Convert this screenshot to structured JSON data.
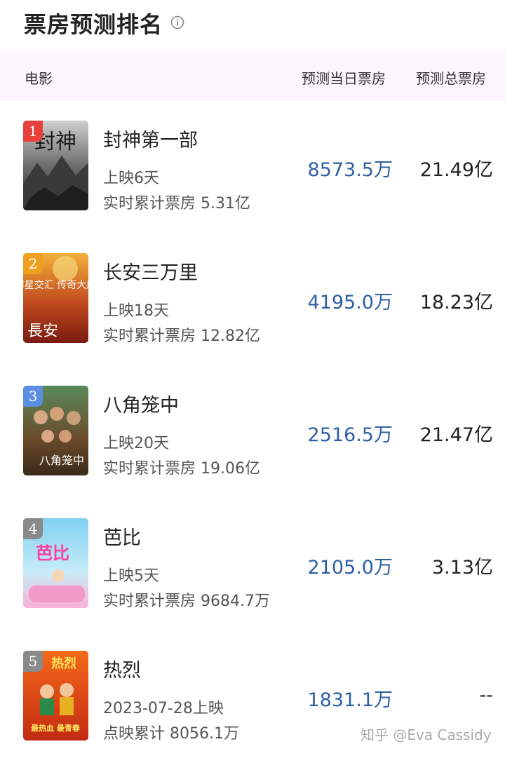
{
  "header": {
    "title": "票房预测排名",
    "info_icon": "info-circle-icon"
  },
  "columns": {
    "movie": "电影",
    "today": "预测当日票房",
    "total": "预测总票房"
  },
  "movies": [
    {
      "rank": "1",
      "title": "封神第一部",
      "meta1": "上映6天",
      "meta2": "实时累计票房 5.31亿",
      "today": "8573.5万",
      "total": "21.49亿",
      "rank_color": "#e8403a"
    },
    {
      "rank": "2",
      "title": "长安三万里",
      "meta1": "上映18天",
      "meta2": "实时累计票房 12.82亿",
      "today": "4195.0万",
      "total": "18.23亿",
      "rank_color": "#f0a020"
    },
    {
      "rank": "3",
      "title": "八角笼中",
      "meta1": "上映20天",
      "meta2": "实时累计票房 19.06亿",
      "today": "2516.5万",
      "total": "21.47亿",
      "rank_color": "#5b8de0"
    },
    {
      "rank": "4",
      "title": "芭比",
      "meta1": "上映5天",
      "meta2": "实时累计票房 9684.7万",
      "today": "2105.0万",
      "total": "3.13亿",
      "rank_color": "#8a8a8a"
    },
    {
      "rank": "5",
      "title": "热烈",
      "meta1": "2023-07-28上映",
      "meta2": "点映累计 8056.1万",
      "today": "1831.1万",
      "total": "--",
      "rank_color": "#8a8a8a"
    }
  ],
  "posters": {
    "p1": {
      "text": "封神"
    },
    "p2": {
      "text": "群星交汇 传奇大唐",
      "text2": "長安"
    },
    "p3": {
      "text": "八角笼中"
    },
    "p4": {
      "text": "芭比"
    },
    "p5": {
      "text": "热烈",
      "text2": "最热血 最青春"
    }
  },
  "watermark": "知乎 @Eva Cassidy"
}
